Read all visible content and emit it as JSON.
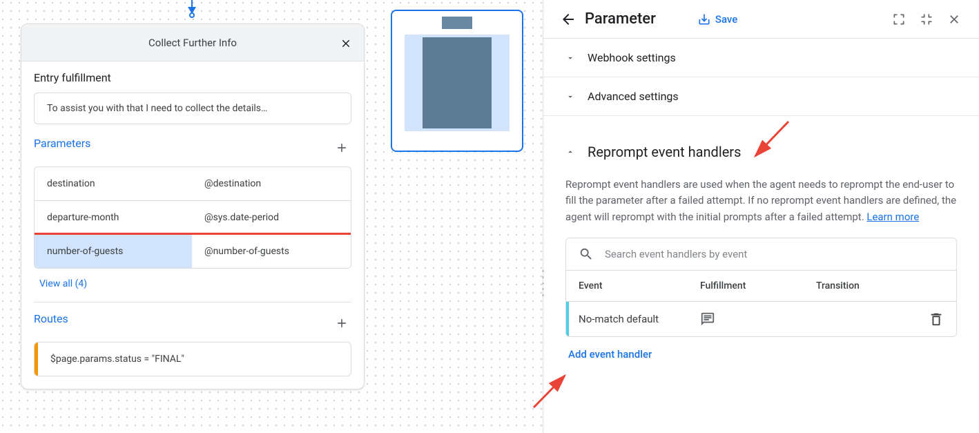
{
  "card": {
    "title": "Collect Further Info",
    "entry_fulfillment_label": "Entry fulfillment",
    "entry_fulfillment_text": "To assist you with that I need to collect the details…",
    "parameters_label": "Parameters",
    "parameters": [
      {
        "name": "destination",
        "type": "@destination"
      },
      {
        "name": "departure-month",
        "type": "@sys.date-period"
      },
      {
        "name": "number-of-guests",
        "type": "@number-of-guests"
      }
    ],
    "view_all": "View all (4)",
    "routes_label": "Routes",
    "route_text": "$page.params.status = \"FINAL\""
  },
  "panel": {
    "title": "Parameter",
    "save": "Save",
    "webhook": "Webhook settings",
    "advanced": "Advanced settings",
    "section_title": "Reprompt event handlers",
    "desc": "Reprompt event handlers are used when the agent needs to reprompt the end-user to fill the parameter after a failed attempt. If no reprompt event handlers are defined, the agent will reprompt with the initial prompts after a failed attempt. ",
    "learn_more": "Learn more",
    "search_placeholder": "Search event handlers by event",
    "th_event": "Event",
    "th_fulfillment": "Fulfillment",
    "th_transition": "Transition",
    "row_event": "No-match default",
    "add_handler": "Add event handler"
  }
}
